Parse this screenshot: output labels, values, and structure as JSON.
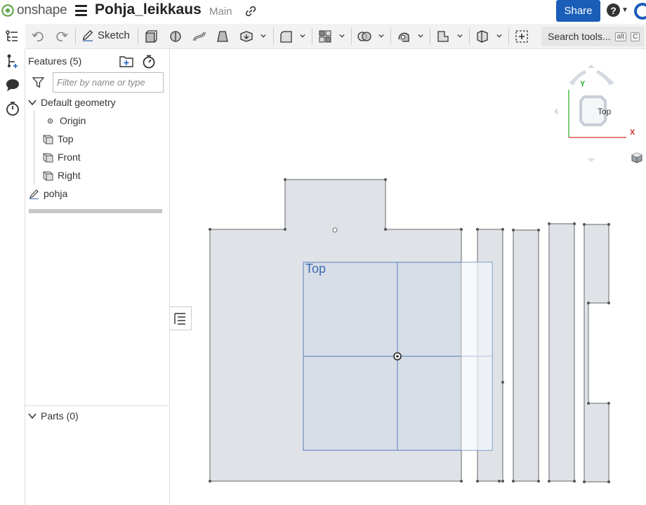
{
  "header": {
    "brand": "onshape",
    "document_title": "Pohja_leikkaus",
    "branch": "Main",
    "share_label": "Share",
    "help_symbol": "?"
  },
  "toolbar": {
    "sketch_label": "Sketch",
    "search_tools_label": "Search tools...",
    "search_kbd_1": "alt",
    "search_kbd_2": "C"
  },
  "features_panel": {
    "header": "Features (5)",
    "filter_placeholder": "Filter by name or type",
    "default_geometry_label": "Default geometry",
    "items": [
      {
        "label": "Origin",
        "icon": "origin-icon"
      },
      {
        "label": "Top",
        "icon": "plane-icon"
      },
      {
        "label": "Front",
        "icon": "plane-icon"
      },
      {
        "label": "Right",
        "icon": "plane-icon"
      }
    ],
    "sketch_item": {
      "label": "pohja",
      "icon": "sketch-pencil-icon"
    },
    "parts_label": "Parts (0)"
  },
  "viewport": {
    "plane_label": "Top",
    "view_cube_face": "Top",
    "axis_y": "Y",
    "axis_x": "X"
  },
  "colors": {
    "accent": "#1a5eb8",
    "sketch_fill": "#dfe3e8",
    "plane_blue": "#3c6bb3",
    "axis_red": "#cc3333",
    "axis_green": "#22aa22"
  }
}
